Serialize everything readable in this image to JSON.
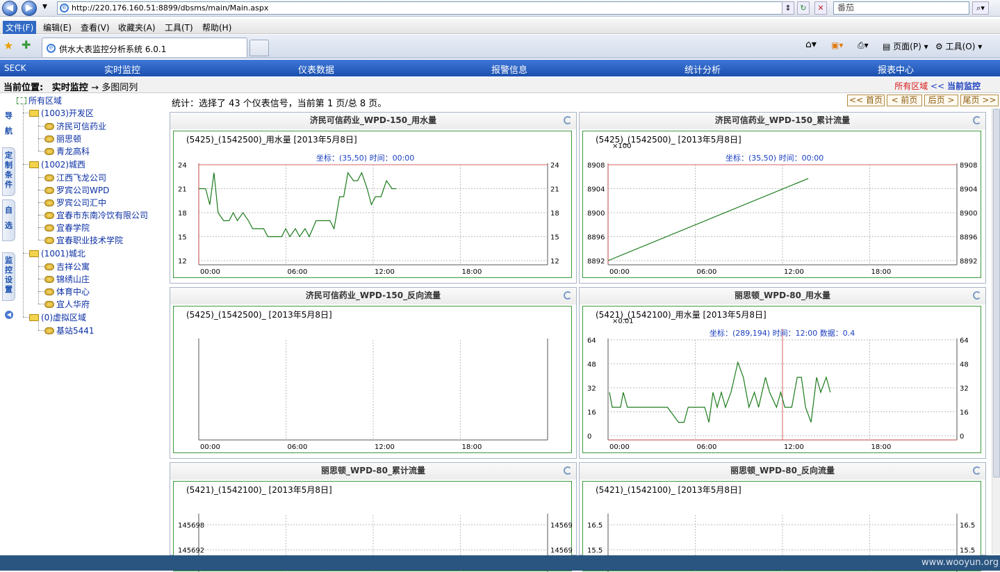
{
  "browser": {
    "url": "http://220.176.160.51:8899/dbsms/main/Main.aspx",
    "search_text": "番茄",
    "menu": [
      "文件(F)",
      "编辑(E)",
      "查看(V)",
      "收藏夹(A)",
      "工具(T)",
      "帮助(H)"
    ],
    "tab_title": "供水大表监控分析系统 6.0.1",
    "cmd_page": "页面(P)",
    "cmd_tools": "工具(O)"
  },
  "app": {
    "brand": "SECK",
    "nav": [
      "实时监控",
      "仪表数据",
      "报警信息",
      "统计分析",
      "报表中心"
    ],
    "crumb_label": "当前位置:",
    "crumb_path": "实时监控",
    "crumb_tail": "→ 多图同列",
    "crumb_right_1": "所有区域",
    "crumb_right_2": "<<",
    "crumb_right_3": "当前监控"
  },
  "sidetabs": [
    "导航",
    "定制条件",
    "自选",
    "监控设置"
  ],
  "tree": {
    "root": "所有区域",
    "groups": [
      {
        "name": "(1003)开发区",
        "items": [
          "济民可信药业",
          "丽思顿",
          "青龙高科"
        ]
      },
      {
        "name": "(1002)城西",
        "items": [
          "江西飞龙公司",
          "罗宾公司WPD",
          "罗宾公司汇中",
          "宜春市东南冷饮有限公司",
          "宜春学院",
          "宜春职业技术学院"
        ]
      },
      {
        "name": "(1001)城北",
        "items": [
          "吉祥公寓",
          "锦绣山庄",
          "体育中心",
          "宜人华府"
        ]
      },
      {
        "name": "(0)虚拟区域",
        "items": [
          "基站5441"
        ]
      }
    ]
  },
  "stats": "统计：选择了 43 个仪表信号，当前第 1 页/总 8 页。",
  "pager": [
    "<< 首页",
    "< 前页",
    "后页 >",
    "尾页 >>"
  ],
  "xticks": [
    "00:00",
    "06:00",
    "12:00",
    "18:00"
  ],
  "charts": [
    {
      "title": "济民可信药业_WPD-150_用水量",
      "subtitle": "(5425)_(1542500)_用水量 [2013年5月8日]",
      "coord_text": "坐标：(35,50)  时间：00:00",
      "yticks": [
        "24",
        "21",
        "18",
        "15",
        "12"
      ],
      "multiplier": ""
    },
    {
      "title": "济民可信药业_WPD-150_累计流量",
      "subtitle": "(5425)_(1542500)_ [2013年5月8日]",
      "coord_text": "坐标：(35,50)  时间：00:00",
      "yticks": [
        "8908",
        "8904",
        "8900",
        "8896",
        "8892"
      ],
      "multiplier": "×100"
    },
    {
      "title": "济民可信药业_WPD-150_反向流量",
      "subtitle": "(5425)_(1542500)_ [2013年5月8日]",
      "coord_text": "",
      "yticks": [],
      "multiplier": ""
    },
    {
      "title": "丽思顿_WPD-80_用水量",
      "subtitle": "(5421)_(1542100)_用水量 [2013年5月8日]",
      "coord_text": "坐标：(289,194)  时间：12:00  数据：0.4",
      "yticks": [
        "64",
        "48",
        "32",
        "16",
        "0"
      ],
      "multiplier": "×0.01"
    },
    {
      "title": "丽思顿_WPD-80_累计流量",
      "subtitle": "(5421)_(1542100)_ [2013年5月8日]",
      "coord_text": "",
      "yticks": [
        "145698",
        "145692"
      ],
      "multiplier": ""
    },
    {
      "title": "丽思顿_WPD-80_反向流量",
      "subtitle": "(5421)_(1542100)_ [2013年5月8日]",
      "coord_text": "",
      "yticks": [
        "16.5",
        "15.5"
      ],
      "multiplier": ""
    }
  ],
  "watermark": "www.wooyun.org",
  "colors": {
    "nav_blue": "#1b4fae",
    "series": "#1a7a1a",
    "frame": "#3a9a3a",
    "ref_line": "#d96060"
  }
}
